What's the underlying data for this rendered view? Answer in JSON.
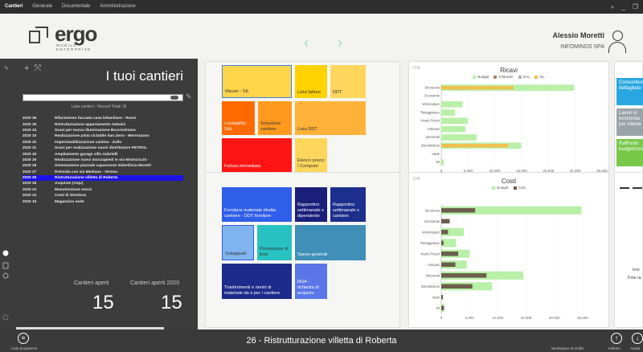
{
  "topbar": {
    "menu": [
      "Cantieri",
      "Generale",
      "Documentale",
      "Amministrazione"
    ],
    "icons": [
      "search-icon",
      "minimize-icon",
      "restore-icon"
    ]
  },
  "header": {
    "logo": {
      "word": "ergo",
      "tag1": "MOBILE",
      "tag2": "ENTERPRISE"
    },
    "nav": {
      "prev": "‹",
      "next": "›"
    },
    "user": {
      "name": "Alessio Moretti",
      "company": "INFOMINDS SPA"
    }
  },
  "left": {
    "title": "I tuoi cantieri",
    "list_count": "Lista cantieri - Record Totali 18",
    "rows": [
      {
        "year": "2020",
        "num": "36",
        "desc": "Rifacimento facciata casa bifamiliare - Rossi"
      },
      {
        "year": "2020",
        "num": "35",
        "desc": "Ristrutturazione appartamento Sebaini"
      },
      {
        "year": "2020",
        "num": "34",
        "desc": "Scavi per nuova illuminazione Bocciodromo"
      },
      {
        "year": "2020",
        "num": "33",
        "desc": "Realizzazione pista ciclabile San Zeno - Merrezzano"
      },
      {
        "year": "2020",
        "num": "32",
        "desc": "Impermeabilizzazione cantina - Zullo"
      },
      {
        "year": "2020",
        "num": "31",
        "desc": "Scavi per realizzazione nuovi distributore PETROL"
      },
      {
        "year": "2020",
        "num": "30",
        "desc": "Ampliamento garage villa Gabrielli"
      },
      {
        "year": "2020",
        "num": "29",
        "desc": "Realizzazione nuovi marciapiedi in via Minincicchi -"
      },
      {
        "year": "2020",
        "num": "28",
        "desc": "Sistemazione piazzale capannone Sidertilicia Moretti"
      },
      {
        "year": "2020",
        "num": "27",
        "desc": "Rotonda con via Mediana - Verona"
      },
      {
        "year": "2020",
        "num": "26",
        "desc": "Ristrutturazione villetta di Roberta"
      },
      {
        "year": "2020",
        "num": "25",
        "desc": "Acquisto (requ)"
      },
      {
        "year": "2020",
        "num": "24",
        "desc": "Manutenzione mezzi"
      },
      {
        "year": "2020",
        "num": "23",
        "desc": "Costi di Struttura"
      },
      {
        "year": "2020",
        "num": "16",
        "desc": "Magazzino sede"
      }
    ],
    "selected_index": 10,
    "stats": [
      {
        "label": "Cantieri aperti",
        "value": "15"
      },
      {
        "label": "Cantieri aperti 2020",
        "value": "15"
      }
    ]
  },
  "tiles_top": [
    {
      "label": "Misure - SIL",
      "color": "#ffd54a"
    },
    {
      "label": "Lista fatture",
      "color": "#ffd200"
    },
    {
      "label": "DDT",
      "color": "#ffd65c"
    },
    {
      "label": "Contabilità - SAL",
      "color": "#ff6a00"
    },
    {
      "label": "Schedone cantiere",
      "color": "#ff9a1f"
    },
    {
      "label": "Lista DDT",
      "color": "#ffb23a"
    },
    {
      "label": "Fattura immediata",
      "color": "#ff1414"
    },
    {
      "label": "Elenco prezzi / Computo",
      "color": "#ffd65c"
    }
  ],
  "tiles_bottom": [
    {
      "label": "Fornitura materiale diretta cantiere - DDT fornitore",
      "color": "#2f5ee8"
    },
    {
      "label": "Rapportino settimanale x dipendente",
      "color": "#1a1f7a"
    },
    {
      "label": "Rapportino settimanale x cantiere",
      "color": "#1d2f8c"
    },
    {
      "label": "Subappalti",
      "color": "#7fb4f0"
    },
    {
      "label": "Prestazione di terzi",
      "color": "#29c2c2"
    },
    {
      "label": "Spese generali",
      "color": "#3f8fb8"
    },
    {
      "label": "Trasferimenti e rientri di materiale da e per i cantiere",
      "color": "#1d2b8c"
    },
    {
      "label": "RDA - richiesta di acquisto",
      "color": "#5a76e8"
    }
  ],
  "ricavi_header": {
    "icons": "⊙⊜"
  },
  "chart_data": [
    {
      "type": "bar",
      "title": "Ricavi",
      "categories": [
        "Sicurezza",
        "Economie",
        "Verniciature",
        "Tinteggiature",
        "Nuovi Prezzi",
        "Intonaci",
        "Interventi",
        "Demolizione",
        "Varie",
        "20"
      ],
      "series": [
        {
          "name": "Budget",
          "color": "#b9f0a8",
          "values": [
            24800,
            0,
            4000,
            2600,
            5000,
            4500,
            6600,
            14900,
            0,
            500
          ]
        },
        {
          "name": "Fatturato",
          "color": "#a38a62",
          "values": [
            6000,
            0,
            0,
            0,
            0,
            0,
            0,
            2000,
            0,
            0
          ]
        },
        {
          "name": "SAL",
          "color": "#b3b3b3",
          "values": [
            0,
            0,
            0,
            0,
            0,
            0,
            0,
            0,
            0,
            0
          ]
        },
        {
          "name": "SIL",
          "color": "#f2c04b",
          "values": [
            13500,
            0,
            0,
            0,
            0,
            0,
            0,
            12500,
            0,
            0
          ]
        }
      ],
      "xticks": [
        "0",
        "5.000",
        "10.000",
        "15.000",
        "20.000",
        "25.000",
        "30.000"
      ],
      "xlim": [
        0,
        30000
      ],
      "legend": "top"
    },
    {
      "type": "bar",
      "title": "Costi",
      "categories": [
        "Sicurezza",
        "Economie",
        "Verniciature",
        "Tinteggiature",
        "Nuovi Prezzi",
        "Intonaci",
        "Interventi",
        "Demolizione",
        "Varie",
        "20"
      ],
      "series": [
        {
          "name": "Budget",
          "color": "#b9f0a8",
          "values": [
            24800,
            0,
            4000,
            2600,
            5000,
            4500,
            14500,
            9000,
            0,
            500
          ]
        },
        {
          "name": "Cost",
          "color": "#6b5f4c",
          "values": [
            6000,
            1500,
            1200,
            400,
            3000,
            2500,
            8000,
            5500,
            300,
            500
          ]
        }
      ],
      "xticks": [
        "0",
        "5.000",
        "10.000",
        "15.000",
        "20.000",
        "25.000"
      ],
      "xlim": [
        0,
        27000
      ],
      "legend": "top"
    }
  ],
  "right_panel": {
    "tiles": [
      {
        "label": "Consuntivo dettagliato",
        "color": "#2aa7e0"
      },
      {
        "label": "Lavori in economia per cliente",
        "color": "#9aa3a8"
      },
      {
        "label": "Raffronto budget/cost",
        "color": "#78c84a"
      }
    ],
    "text1": "Insi",
    "text2": "Fine la"
  },
  "bottom": {
    "title": "26 - Ristrutturazione villetta di Roberta",
    "left_label": "Lista programmi",
    "right_labels": [
      "Workspace di profilo",
      "Indietro",
      "Avanti"
    ]
  }
}
